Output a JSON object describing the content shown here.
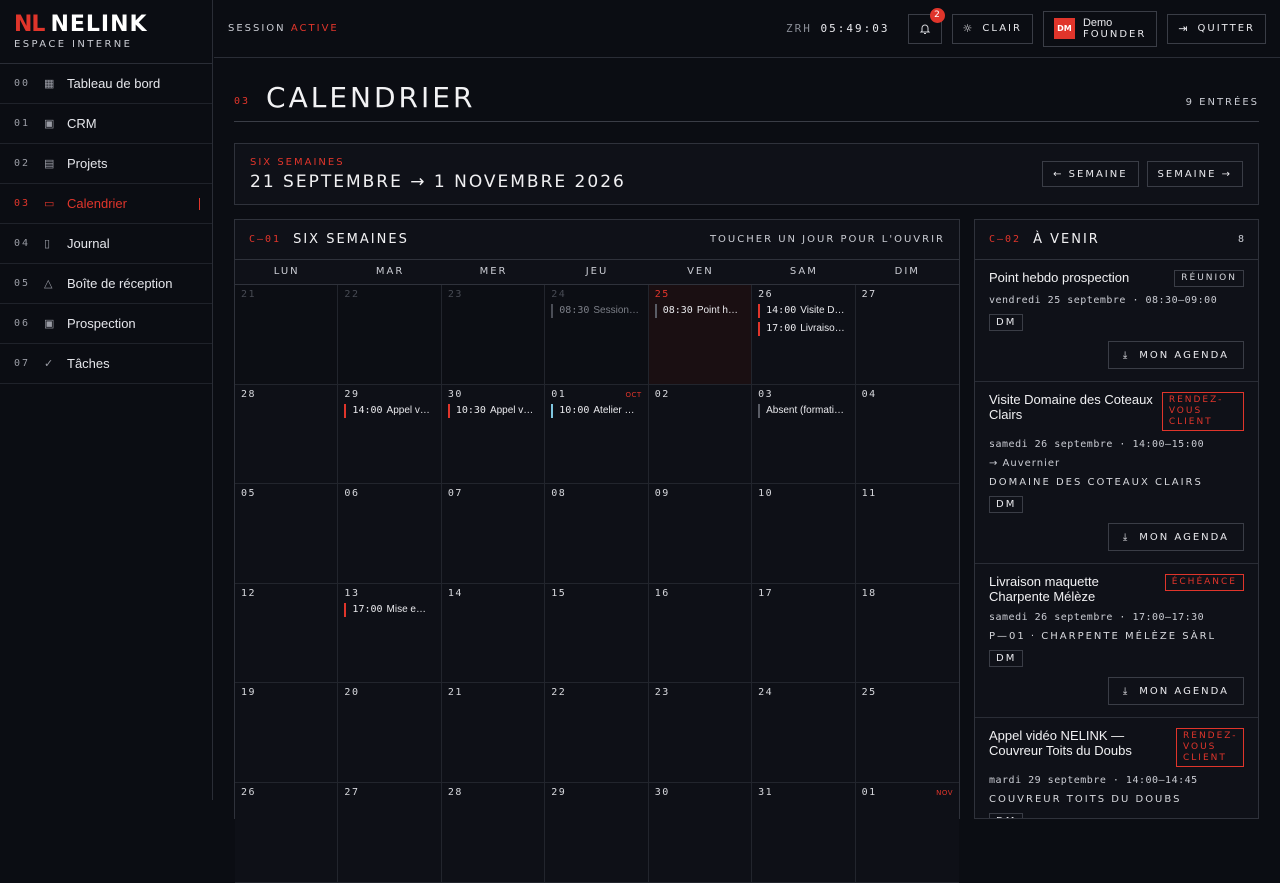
{
  "brand": {
    "mark": "NL",
    "name": "NELINK",
    "subtitle": "ESPACE INTERNE"
  },
  "nav": [
    {
      "num": "00",
      "icon": "dashboard-icon",
      "glyph": "▦",
      "label": "Tableau de bord",
      "active": false
    },
    {
      "num": "01",
      "icon": "crm-icon",
      "glyph": "▣",
      "label": "CRM",
      "active": false
    },
    {
      "num": "02",
      "icon": "projects-icon",
      "glyph": "▤",
      "label": "Projets",
      "active": false
    },
    {
      "num": "03",
      "icon": "calendar-icon",
      "glyph": "▭",
      "label": "Calendrier",
      "active": true
    },
    {
      "num": "04",
      "icon": "journal-icon",
      "glyph": "▯",
      "label": "Journal",
      "active": false
    },
    {
      "num": "05",
      "icon": "bell-icon",
      "glyph": "△",
      "label": "Boîte de réception",
      "active": false
    },
    {
      "num": "06",
      "icon": "prospection-icon",
      "glyph": "▣",
      "label": "Prospection",
      "active": false
    },
    {
      "num": "07",
      "icon": "check-icon",
      "glyph": "✓",
      "label": "Tâches",
      "active": false
    }
  ],
  "topbar": {
    "session_label": "SESSION",
    "session_status": "ACTIVE",
    "clock_zone": "ZRH",
    "clock_time": "05:49:03",
    "notifications": "2",
    "theme_label": "CLAIR",
    "user_initials": "DM",
    "user_name": "Demo",
    "user_role": "FOUNDER",
    "quit_label": "QUITTER"
  },
  "page": {
    "num": "03",
    "title": "CALENDRIER",
    "count": "9 ENTRÉES"
  },
  "range": {
    "label": "SIX SEMAINES",
    "text": "21 SEPTEMBRE → 1 NOVEMBRE 2026",
    "prev": "← SEMAINE",
    "next": "SEMAINE →"
  },
  "calendar": {
    "code": "C—01",
    "title": "SIX SEMAINES",
    "hint": "TOUCHER UN JOUR POUR L'OUVRIR",
    "weekdays": [
      "LUN",
      "MAR",
      "MER",
      "JEU",
      "VEN",
      "SAM",
      "DIM"
    ],
    "days": [
      {
        "d": "21",
        "out": true
      },
      {
        "d": "22",
        "out": true
      },
      {
        "d": "23",
        "out": true
      },
      {
        "d": "24",
        "out": true,
        "events": [
          {
            "t": "08:30",
            "x": "Session…",
            "kind": "dim"
          }
        ]
      },
      {
        "d": "25",
        "today": true,
        "events": [
          {
            "t": "08:30",
            "x": "Point h…",
            "kind": "grey"
          }
        ]
      },
      {
        "d": "26",
        "events": [
          {
            "t": "14:00",
            "x": "Visite D…",
            "kind": "red"
          },
          {
            "t": "17:00",
            "x": "Livraiso…",
            "kind": "red"
          }
        ]
      },
      {
        "d": "27"
      },
      {
        "d": "28"
      },
      {
        "d": "29",
        "events": [
          {
            "t": "14:00",
            "x": "Appel v…",
            "kind": "red"
          }
        ]
      },
      {
        "d": "30",
        "events": [
          {
            "t": "10:30",
            "x": "Appel v…",
            "kind": "red"
          }
        ]
      },
      {
        "d": "01",
        "month": "OCT",
        "events": [
          {
            "t": "10:00",
            "x": "Atelier …",
            "kind": "blue"
          }
        ]
      },
      {
        "d": "02"
      },
      {
        "d": "03",
        "events": [
          {
            "t": "",
            "x": "Absent (formati…",
            "kind": "grey"
          }
        ]
      },
      {
        "d": "04"
      },
      {
        "d": "05"
      },
      {
        "d": "06"
      },
      {
        "d": "07"
      },
      {
        "d": "08"
      },
      {
        "d": "09"
      },
      {
        "d": "10"
      },
      {
        "d": "11"
      },
      {
        "d": "12"
      },
      {
        "d": "13",
        "events": [
          {
            "t": "17:00",
            "x": "Mise e…",
            "kind": "red"
          }
        ]
      },
      {
        "d": "14"
      },
      {
        "d": "15"
      },
      {
        "d": "16"
      },
      {
        "d": "17"
      },
      {
        "d": "18"
      },
      {
        "d": "19"
      },
      {
        "d": "20"
      },
      {
        "d": "21"
      },
      {
        "d": "22"
      },
      {
        "d": "23"
      },
      {
        "d": "24"
      },
      {
        "d": "25"
      },
      {
        "d": "26"
      },
      {
        "d": "27"
      },
      {
        "d": "28"
      },
      {
        "d": "29"
      },
      {
        "d": "30"
      },
      {
        "d": "31"
      },
      {
        "d": "01",
        "month": "NOV"
      }
    ]
  },
  "upcoming": {
    "code": "C—02",
    "title": "À VENIR",
    "count": "8",
    "agenda_label": "MON AGENDA",
    "items": [
      {
        "title": "Point hebdo prospection",
        "tag": "RÉUNION",
        "tag_red": false,
        "date": "vendredi 25 septembre · 08:30–09:00",
        "lines": [],
        "owner": "DM"
      },
      {
        "title": "Visite Domaine des Coteaux Clairs",
        "tag": "RENDEZ-VOUS CLIENT",
        "tag_red": true,
        "date": "samedi 26 septembre · 14:00–15:00",
        "lines": [
          "→ Auvernier"
        ],
        "org": "DOMAINE DES COTEAUX CLAIRS",
        "owner": "DM"
      },
      {
        "title": "Livraison maquette Charpente Mélèze",
        "tag": "ÉCHÉANCE",
        "tag_red": true,
        "date": "samedi 26 septembre · 17:00–17:30",
        "lines": [],
        "org": "P—01 · CHARPENTE MÉLÈZE SÀRL",
        "owner": "DM"
      },
      {
        "title": "Appel vidéo NELINK — Couvreur Toits du Doubs",
        "tag": "RENDEZ-VOUS CLIENT",
        "tag_red": true,
        "date": "mardi 29 septembre · 14:00–14:45",
        "lines": [],
        "org": "COUVREUR TOITS DU DOUBS",
        "owner": "DM"
      }
    ]
  }
}
